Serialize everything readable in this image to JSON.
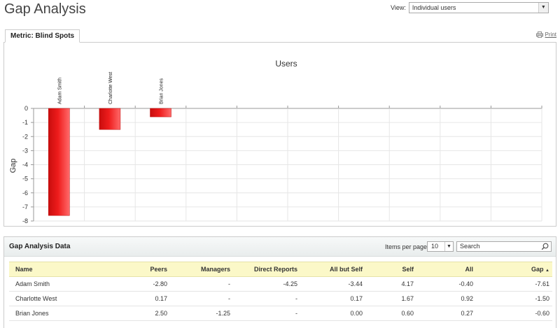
{
  "page": {
    "title": "Gap Analysis"
  },
  "view": {
    "label": "View:",
    "selected": "Individual users"
  },
  "metric_tab": {
    "label": "Metric: Blind Spots"
  },
  "print": {
    "label": "Print"
  },
  "chart_data": {
    "type": "bar",
    "title": "Users",
    "xlabel": "",
    "ylabel": "Gap",
    "categories": [
      "Adam Smith",
      "Charlotte West",
      "Brian Jones"
    ],
    "values": [
      -7.61,
      -1.5,
      -0.6
    ],
    "ylim": [
      -8,
      0
    ],
    "yticks": [
      0,
      -1,
      -2,
      -3,
      -4,
      -5,
      -6,
      -7,
      -8
    ],
    "slot_count": 10,
    "grid": true,
    "bar_color": "#ee1c1c"
  },
  "data_section": {
    "title": "Gap Analysis Data",
    "items_per_page_label": "Items per page",
    "items_per_page_value": "10",
    "search_placeholder": "Search"
  },
  "table": {
    "columns": [
      "Name",
      "Peers",
      "Managers",
      "Direct Reports",
      "All but Self",
      "Self",
      "All",
      "Gap"
    ],
    "sort_indicator": "▲",
    "rows": [
      [
        "Adam Smith",
        "-2.80",
        "-",
        "-4.25",
        "-3.44",
        "4.17",
        "-0.40",
        "-7.61"
      ],
      [
        "Charlotte West",
        "0.17",
        "-",
        "-",
        "0.17",
        "1.67",
        "0.92",
        "-1.50"
      ],
      [
        "Brian Jones",
        "2.50",
        "-1.25",
        "-",
        "0.00",
        "0.60",
        "0.27",
        "-0.60"
      ]
    ]
  }
}
